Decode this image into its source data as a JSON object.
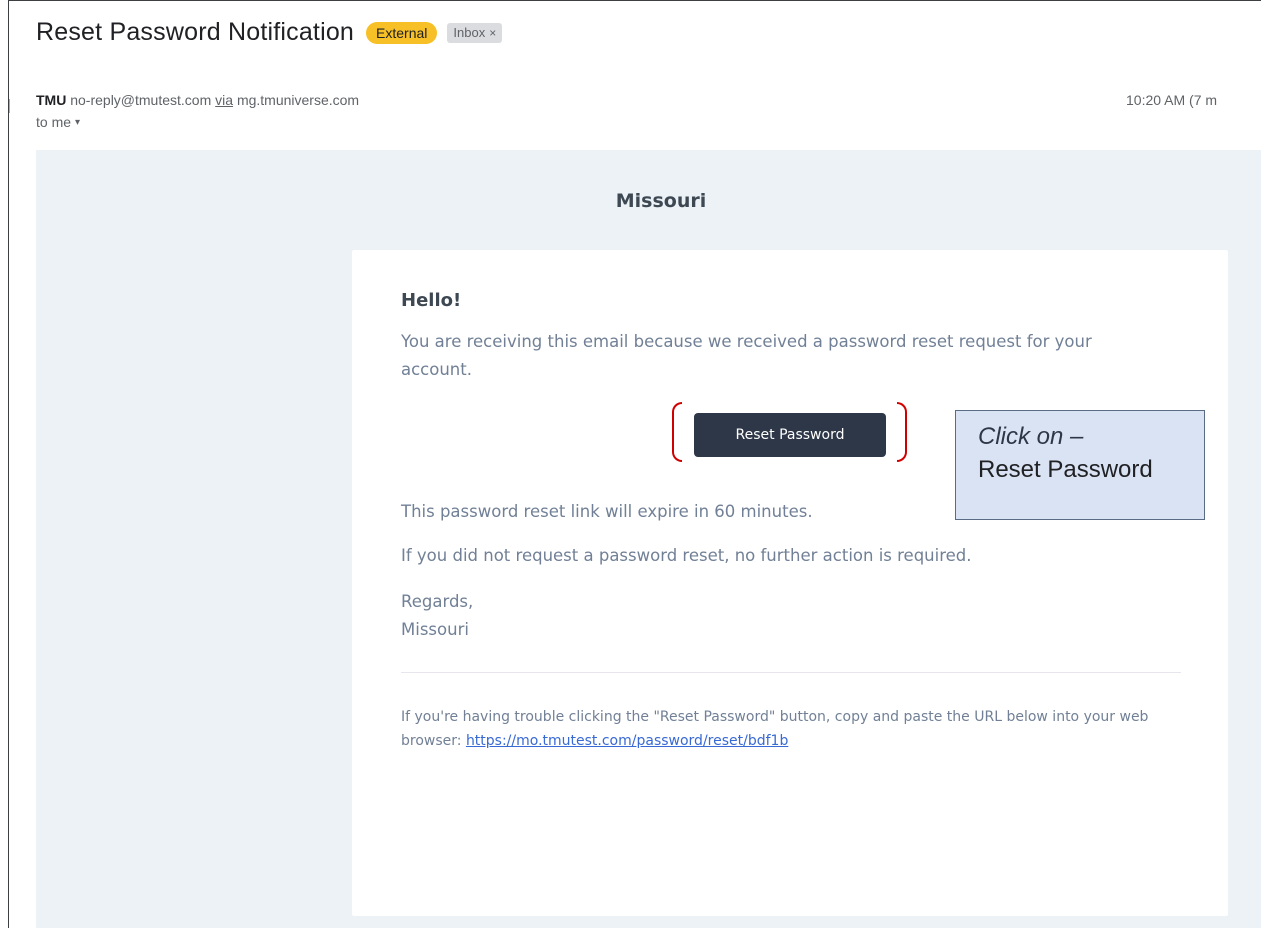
{
  "subject": "Reset Password Notification",
  "labels": {
    "external": "External",
    "inbox": "Inbox",
    "inbox_close": "×"
  },
  "sender": {
    "name": "TMU",
    "email": "no-reply@tmutest.com",
    "via_label": "via",
    "via_domain": "mg.tmuniverse.com"
  },
  "recipient": {
    "to": "to me",
    "caret": "▾"
  },
  "timestamp": "10:20 AM (7 m",
  "email": {
    "brand": "Missouri",
    "greeting": "Hello!",
    "intro": "You are receiving this email because we received a password reset request for your account.",
    "button_label": "Reset Password",
    "expire_note": "This password reset link will expire in 60 minutes.",
    "no_action_note": "If you did not request a password reset, no further action is required.",
    "regards": "Regards,",
    "signature": "Missouri",
    "trouble_text": "If you're having trouble clicking the \"Reset Password\" button, copy and paste the URL below into your web browser:",
    "reset_url": "https://mo.tmutest.com/password/reset/bdf1b"
  },
  "callout": {
    "line1": "Click on –",
    "line2": "Reset Password"
  },
  "colors": {
    "external_badge": "#f6c026",
    "email_background": "#edf2f7",
    "button": "#2d3748",
    "highlight_bracket": "#d00000",
    "callout_fill": "#dae3f3",
    "link": "#3869d4"
  }
}
